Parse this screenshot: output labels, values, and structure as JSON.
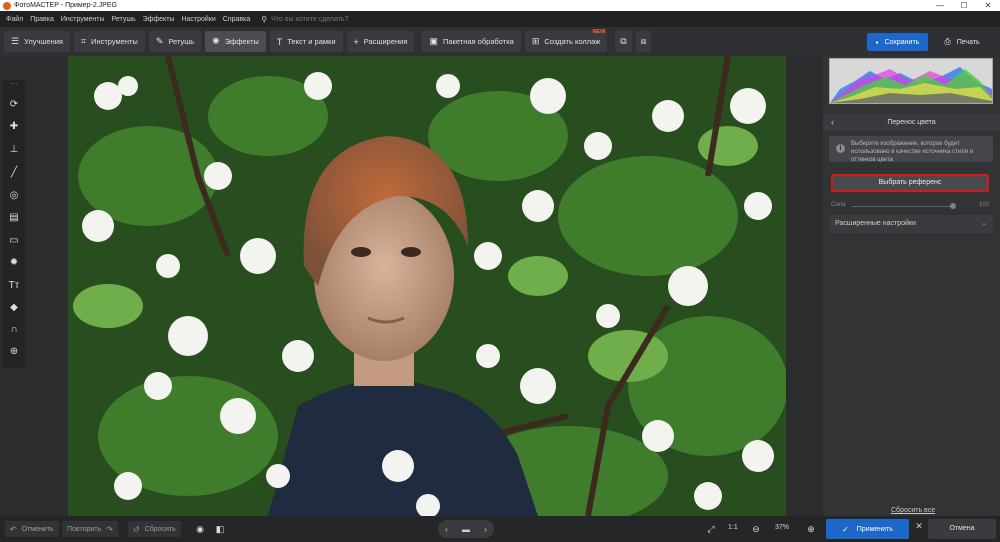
{
  "window": {
    "title": "ФотоМАСТЕР - Пример-2.JPEG",
    "minimize": "—",
    "maximize": "☐",
    "close": "✕"
  },
  "menu": {
    "items": [
      "Файл",
      "Правка",
      "Инструменты",
      "Ретушь",
      "Эффекты",
      "Настройки",
      "Справка"
    ],
    "search_placeholder": "Что вы хотите сделать?"
  },
  "toolbar": {
    "tabs": [
      {
        "label": "Улучшения",
        "icon": "sliders-icon"
      },
      {
        "label": "Инструменты",
        "icon": "crop-icon"
      },
      {
        "label": "Ретушь",
        "icon": "brush-icon"
      },
      {
        "label": "Эффекты",
        "icon": "sparkle-icon",
        "active": true
      },
      {
        "label": "Текст и рамки",
        "icon": "text-icon"
      },
      {
        "label": "Расширения",
        "icon": "plus-icon"
      }
    ],
    "batch_label": "Пакетная обработка",
    "collage_label": "Создать коллаж",
    "collage_badge": "NEW",
    "save_label": "Сохранить",
    "print_label": "Печать"
  },
  "left_tools": [
    "arrows-icon",
    "bandage-icon",
    "stamp-icon",
    "brush-icon",
    "spot-icon",
    "gradient-icon",
    "vignette-icon",
    "sun-icon",
    "text-icon",
    "bucket-icon",
    "magnet-icon",
    "globe-icon"
  ],
  "panel": {
    "title": "Перенос цвета",
    "hint": "Выберите изображение, которое будет использовано в качестве источника стиля и оттенков цвета",
    "reference_button": "Выбрать референс",
    "strength_label": "Сила",
    "strength_value": "100",
    "strength_level": 0.98,
    "advanced_label": "Расширенные настройки",
    "reset_all": "Сбросить все",
    "accent_color": "#1c67c8",
    "highlight_color": "#d11a1a"
  },
  "bottom": {
    "undo_label": "Отменить",
    "redo_label": "Повторить",
    "reset_label": "Сбросить",
    "one_to_one": "1:1",
    "zoom_value": "37%",
    "apply_label": "Применить",
    "cancel_label": "Отмена"
  }
}
